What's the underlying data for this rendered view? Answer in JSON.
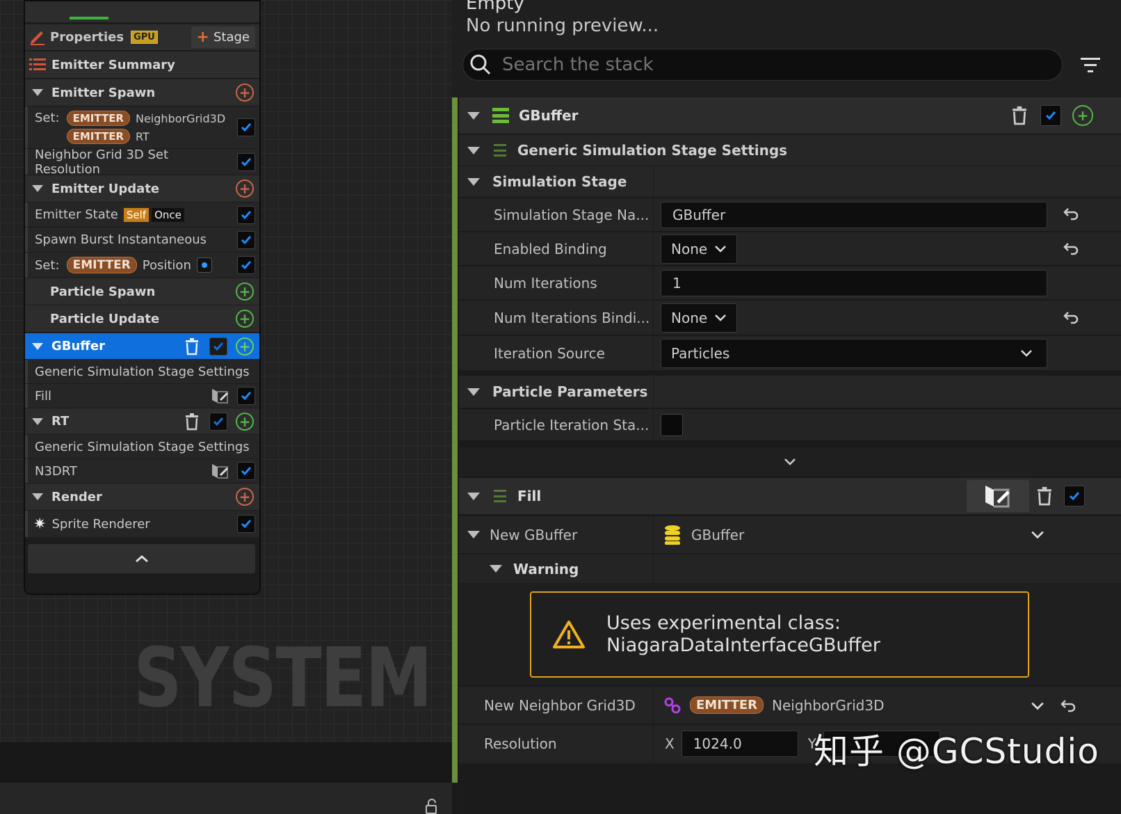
{
  "canvas": {
    "watermark": "SYSTEM"
  },
  "node": {
    "properties_label": "Properties",
    "gpu_badge": "GPU",
    "stage_button": "Stage",
    "emitter_summary": "Emitter Summary",
    "emitter_spawn": {
      "title": "Emitter Spawn",
      "set_label": "Set:",
      "set_items": [
        {
          "tag": "EMITTER",
          "name": "NeighborGrid3D"
        },
        {
          "tag": "EMITTER",
          "name": "RT"
        }
      ],
      "resolution_item": "Neighbor Grid 3D Set Resolution"
    },
    "emitter_update": {
      "title": "Emitter Update",
      "state_item": "Emitter State",
      "self_badge": "Self",
      "once_badge": "Once",
      "burst_item": "Spawn Burst Instantaneous",
      "set_label": "Set:",
      "set_tag": "EMITTER",
      "set_name": "Position"
    },
    "particle_spawn": "Particle Spawn",
    "particle_update": "Particle Update",
    "gbuffer": {
      "title": "GBuffer",
      "settings": "Generic Simulation Stage Settings",
      "fill": "Fill"
    },
    "rt": {
      "title": "RT",
      "settings": "Generic Simulation Stage Settings",
      "n3drt": "N3DRT"
    },
    "render": {
      "title": "Render",
      "sprite": "Sprite Renderer"
    }
  },
  "panel": {
    "title_partial": "Empty",
    "preview_status": "No running preview...",
    "search_placeholder": "Search the stack",
    "gbuffer_header": "GBuffer",
    "generic_settings": "Generic Simulation Stage Settings",
    "simulation_stage": "Simulation Stage",
    "props": {
      "stage_name_label": "Simulation Stage Na...",
      "stage_name_value": "GBuffer",
      "enabled_binding_label": "Enabled Binding",
      "enabled_binding_value": "None",
      "num_iterations_label": "Num Iterations",
      "num_iterations_value": "1",
      "num_iter_binding_label": "Num Iterations Bindi...",
      "num_iter_binding_value": "None",
      "iteration_source_label": "Iteration Source",
      "iteration_source_value": "Particles"
    },
    "particle_parameters": "Particle Parameters",
    "particle_iteration_label": "Particle Iteration Sta...",
    "fill_header": "Fill",
    "new_gbuffer_label": "New GBuffer",
    "new_gbuffer_value": "GBuffer",
    "warning_label": "Warning",
    "warning_line1": "Uses experimental class:",
    "warning_line2": "NiagaraDataInterfaceGBuffer",
    "new_neighbor_label": "New Neighbor Grid3D",
    "new_neighbor_tag": "EMITTER",
    "new_neighbor_value": "NeighborGrid3D",
    "resolution_label": "Resolution",
    "res_x_label": "X",
    "res_x_value": "1024.0",
    "res_y_label": "Y"
  },
  "watermark": "知乎 @GCStudio",
  "colors": {
    "accent_blue": "#0f6fdc",
    "checkbox_blue": "#1a8cff",
    "warning": "#e0a21a",
    "emitter_pill": "#8a4e26",
    "green": "#54b44a"
  }
}
